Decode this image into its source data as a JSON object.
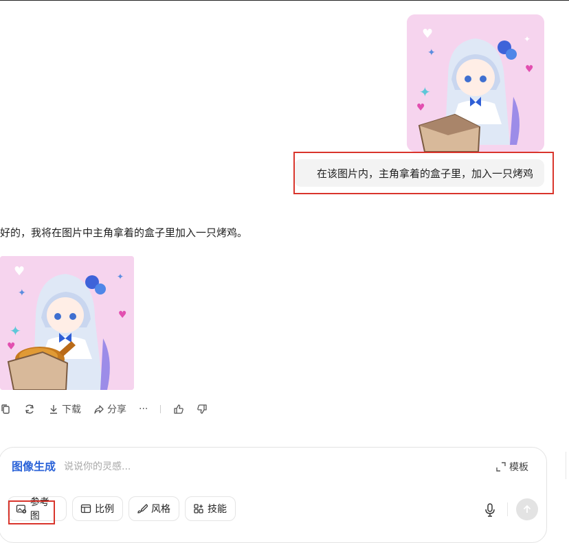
{
  "conversation": {
    "user_prompt": "在该图片内，主角拿着的盒子里，加入一只烤鸡",
    "assistant_reply": "好的，我将在图片中主角拿着的盒子里加入一只烤鸡。"
  },
  "actions": {
    "download": "下载",
    "share": "分享",
    "more": "···"
  },
  "composer": {
    "mode": "图像生成",
    "placeholder": "说说你的灵感...",
    "template": "模板",
    "chips": {
      "reference": "参考图",
      "ratio": "比例",
      "style": "风格",
      "skill": "技能"
    }
  },
  "colors": {
    "accent": "#2b63d8",
    "highlight_box": "#d9342b",
    "image_background": "#f6d4ee"
  }
}
